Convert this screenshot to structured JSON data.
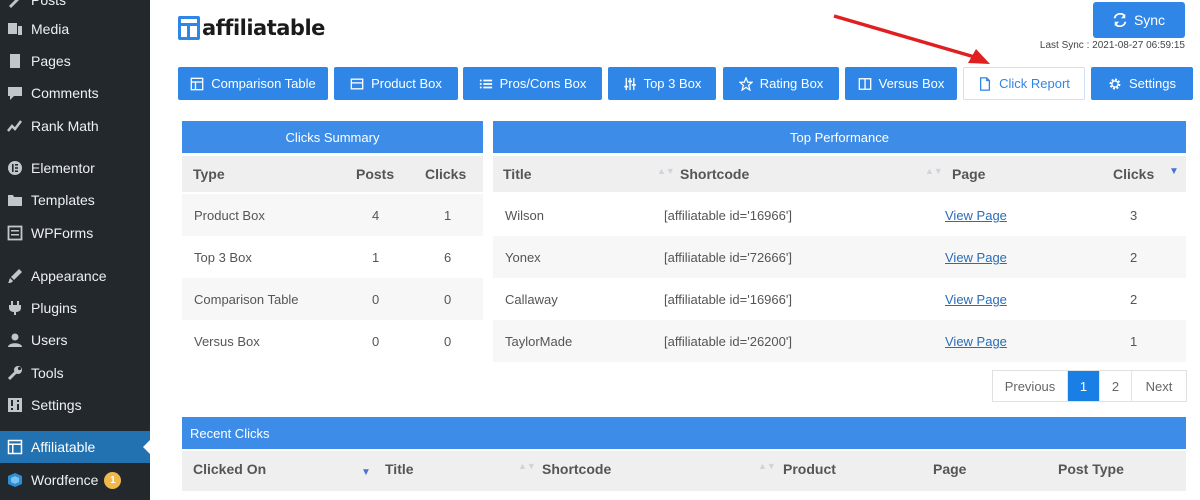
{
  "sidebar": {
    "items": [
      {
        "label": "Posts",
        "icon": "posts-icon"
      },
      {
        "label": "Media",
        "icon": "media-icon"
      },
      {
        "label": "Pages",
        "icon": "pages-icon"
      },
      {
        "label": "Comments",
        "icon": "comments-icon"
      },
      {
        "label": "Rank Math",
        "icon": "rank-math-icon"
      },
      {
        "label": "Elementor",
        "icon": "elementor-icon"
      },
      {
        "label": "Templates",
        "icon": "templates-icon"
      },
      {
        "label": "WPForms",
        "icon": "wpforms-icon"
      },
      {
        "label": "Appearance",
        "icon": "appearance-icon"
      },
      {
        "label": "Plugins",
        "icon": "plugins-icon"
      },
      {
        "label": "Users",
        "icon": "users-icon"
      },
      {
        "label": "Tools",
        "icon": "tools-icon"
      },
      {
        "label": "Settings",
        "icon": "settings-icon"
      },
      {
        "label": "Affiliatable",
        "icon": "affiliatable-icon",
        "active": true
      },
      {
        "label": "Wordfence",
        "icon": "wordfence-icon",
        "badge": "1"
      }
    ]
  },
  "header": {
    "brand": "affiliatable",
    "sync_label": "Sync",
    "last_sync": "Last Sync : 2021-08-27 06:59:15"
  },
  "tabs": [
    {
      "label": "Comparison Table",
      "icon": "table-icon"
    },
    {
      "label": "Product Box",
      "icon": "product-box-icon"
    },
    {
      "label": "Pros/Cons Box",
      "icon": "list-icon"
    },
    {
      "label": "Top 3 Box",
      "icon": "sliders-icon"
    },
    {
      "label": "Rating Box",
      "icon": "star-icon"
    },
    {
      "label": "Versus Box",
      "icon": "columns-icon"
    },
    {
      "label": "Click Report",
      "icon": "file-icon",
      "active": true
    },
    {
      "label": "Settings",
      "icon": "gear-icon"
    }
  ],
  "clicks_summary": {
    "title": "Clicks Summary",
    "columns": [
      "Type",
      "Posts",
      "Clicks"
    ],
    "rows": [
      [
        "Product Box",
        "4",
        "1"
      ],
      [
        "Top 3 Box",
        "1",
        "6"
      ],
      [
        "Comparison Table",
        "0",
        "0"
      ],
      [
        "Versus Box",
        "0",
        "0"
      ]
    ]
  },
  "top_performance": {
    "title": "Top Performance",
    "columns": [
      "Title",
      "Shortcode",
      "Page",
      "Clicks"
    ],
    "rows": [
      [
        "Wilson",
        "[affiliatable id='16966']",
        "View Page",
        "3"
      ],
      [
        "Yonex",
        "[affiliatable id='72666']",
        "View Page",
        "2"
      ],
      [
        "Callaway",
        "[affiliatable id='16966']",
        "View Page",
        "2"
      ],
      [
        "TaylorMade",
        "[affiliatable id='26200']",
        "View Page",
        "1"
      ]
    ]
  },
  "pagination": {
    "previous": "Previous",
    "pages": [
      "1",
      "2"
    ],
    "current": "1",
    "next": "Next"
  },
  "recent_clicks": {
    "title": "Recent Clicks",
    "columns": [
      "Clicked On",
      "Title",
      "Shortcode",
      "Product",
      "Page",
      "Post Type"
    ]
  },
  "colors": {
    "accent": "#2f86e6",
    "sidebar_bg": "#23282d",
    "sidebar_active": "#2271b1",
    "annotation_arrow": "#e02020"
  }
}
